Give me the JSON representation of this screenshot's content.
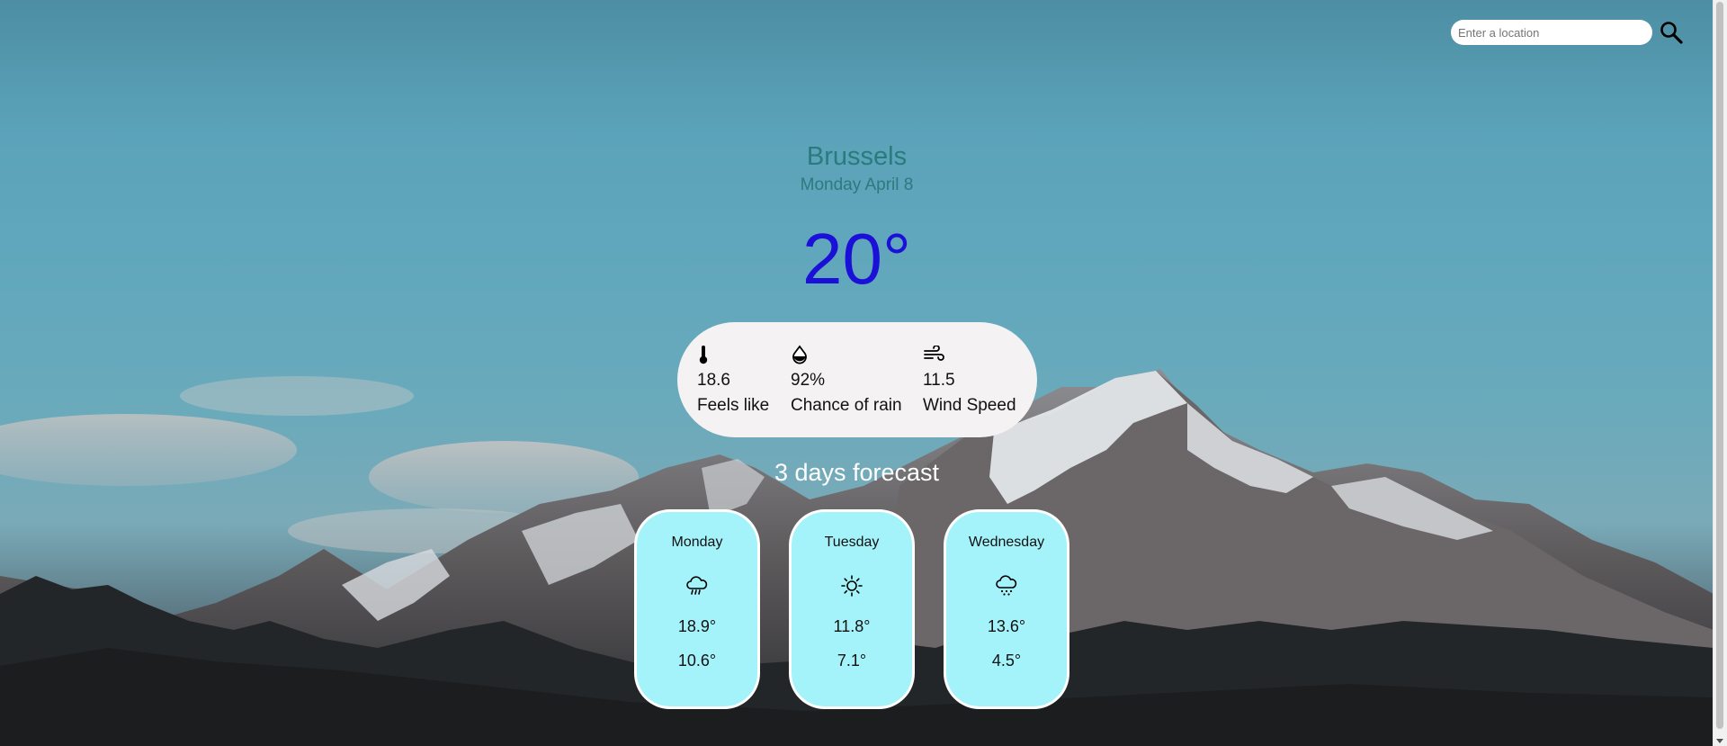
{
  "search": {
    "placeholder": "Enter a location",
    "value": ""
  },
  "location": {
    "city": "Brussels",
    "date": "Monday April 8"
  },
  "current": {
    "temperature": "20°",
    "stats": [
      {
        "icon": "thermometer-icon",
        "value": "18.6",
        "label": "Feels like"
      },
      {
        "icon": "raindrop-icon",
        "value": "92%",
        "label": "Chance of rain"
      },
      {
        "icon": "wind-icon",
        "value": "11.5",
        "label": "Wind Speed"
      }
    ]
  },
  "forecast": {
    "title": "3 days forecast",
    "days": [
      {
        "day": "Monday",
        "icon": "rain-cloud-icon",
        "high": "18.9°",
        "low": "10.6°"
      },
      {
        "day": "Tuesday",
        "icon": "sun-icon",
        "high": "11.8°",
        "low": "7.1°"
      },
      {
        "day": "Wednesday",
        "icon": "snow-cloud-icon",
        "high": "13.6°",
        "low": "4.5°"
      }
    ]
  },
  "colors": {
    "city_text": "#2c7a7e",
    "temperature_text": "#1a10d8",
    "stats_panel": "#f4f2f3",
    "card_background": "#a5f3fa",
    "card_border": "#ffffff"
  }
}
